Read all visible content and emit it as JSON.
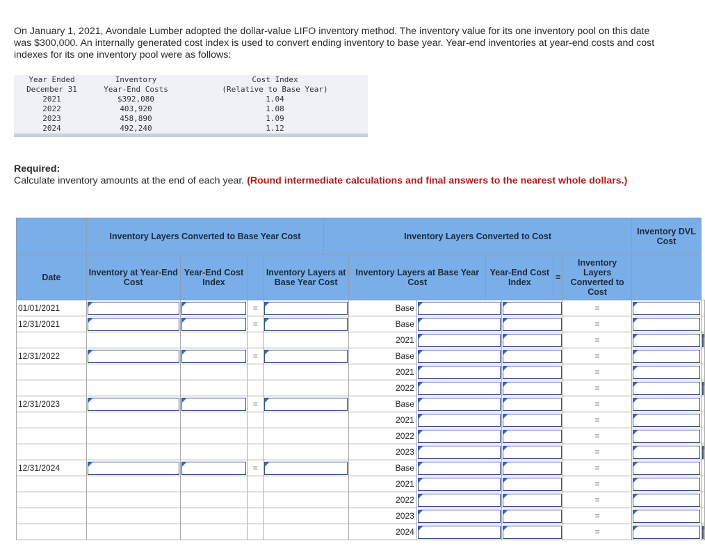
{
  "intro": "On January 1, 2021, Avondale Lumber adopted the dollar-value LIFO inventory method. The inventory value for its one inventory pool on this date was $300,000. An internally generated cost index is used to convert ending inventory to base year. Year-end inventories at year-end costs and cost indexes for its one inventory pool were as follows:",
  "given": {
    "headers": {
      "year_line1": "Year Ended",
      "year_line2": "December 31",
      "inv_line1": "Inventory",
      "inv_line2": "Year-End Costs",
      "idx_line1": "Cost Index",
      "idx_line2": "(Relative to Base Year)"
    },
    "rows": [
      {
        "year": "2021",
        "cost": "$392,080",
        "index": "1.04"
      },
      {
        "year": "2022",
        "cost": "403,920",
        "index": "1.08"
      },
      {
        "year": "2023",
        "cost": "458,890",
        "index": "1.09"
      },
      {
        "year": "2024",
        "cost": "492,240",
        "index": "1.12"
      }
    ]
  },
  "required": {
    "heading": "Required:",
    "text": "Calculate inventory amounts at the end of each year.",
    "note": "(Round intermediate calculations and final answers to the nearest whole dollars.)"
  },
  "table": {
    "group_base": "Inventory Layers Converted to Base Year Cost",
    "group_cost": "Inventory Layers Converted to Cost",
    "dvl": "Inventory DVL Cost",
    "date": "Date",
    "inv_ye": "Inventory at Year-End Cost",
    "ye_index": "Year-End Cost Index",
    "inv_base": "Inventory Layers at Base Year Cost",
    "layers_base": "Inventory Layers at Base Year Cost",
    "ye_index2": "Year-End Cost Index",
    "eq": "=",
    "converted": "Inventory Layers Converted to Cost",
    "rows": [
      {
        "date": "01/01/2021",
        "layer": "Base"
      },
      {
        "date": "12/31/2021",
        "layer": "Base"
      },
      {
        "date": "",
        "layer": "2021"
      },
      {
        "date": "12/31/2022",
        "layer": "Base"
      },
      {
        "date": "",
        "layer": "2021"
      },
      {
        "date": "",
        "layer": "2022"
      },
      {
        "date": "12/31/2023",
        "layer": "Base"
      },
      {
        "date": "",
        "layer": "2021"
      },
      {
        "date": "",
        "layer": "2022"
      },
      {
        "date": "",
        "layer": "2023"
      },
      {
        "date": "12/31/2024",
        "layer": "Base"
      },
      {
        "date": "",
        "layer": "2021"
      },
      {
        "date": "",
        "layer": "2022"
      },
      {
        "date": "",
        "layer": "2023"
      },
      {
        "date": "",
        "layer": "2024"
      }
    ]
  }
}
